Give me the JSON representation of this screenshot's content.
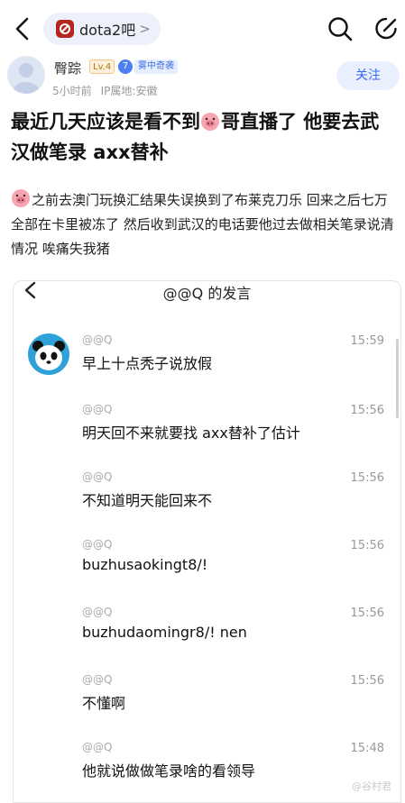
{
  "nav": {
    "forum_name": "dota2吧",
    "chevron": ">"
  },
  "author": {
    "name": "臀踪",
    "level": "Lv.4",
    "badge_number": "7",
    "badge_text": "雾中奇袭",
    "time": "5小时前",
    "ip_location": "IP属地:安徽",
    "follow_label": "关注"
  },
  "post": {
    "title_part1": "最近几天应该是看不到",
    "title_part2": "哥直播了 他要去武汉做笔录 axx替补",
    "body_text": "之前去澳门玩换汇结果失误换到了布莱克刀乐 回来之后七万全部在卡里被冻了 然后收到武汉的电话要他过去做相关笔录说清情况 唉痛失我猪"
  },
  "screenshot": {
    "title": "@@Q 的发言",
    "messages": [
      {
        "sender": "@@Q",
        "time": "15:59",
        "text": "早上十点秃子说放假"
      },
      {
        "sender": "@@Q",
        "time": "15:56",
        "text": "明天回不来就要找 axx替补了估计"
      },
      {
        "sender": "@@Q",
        "time": "15:56",
        "text": "不知道明天能回来不"
      },
      {
        "sender": "@@Q",
        "time": "15:56",
        "text": "buzhusaokingt8/!"
      },
      {
        "sender": "@@Q",
        "time": "15:56",
        "text": "buzhudaomingr8/!  nen"
      },
      {
        "sender": "@@Q",
        "time": "15:56",
        "text": "不懂啊"
      },
      {
        "sender": "@@Q",
        "time": "15:48",
        "text": "他就说做做笔录啥的看领导"
      }
    ]
  },
  "watermark": "@谷村君",
  "colors": {
    "accent": "#3766f4",
    "forum_pill_bg": "#eef0fb",
    "follow_bg": "#eaf0fe",
    "level_text": "#b47718",
    "badge_blue": "#4b7ff2"
  },
  "icons": [
    "back-arrow-icon",
    "forum-logo-icon",
    "search-icon",
    "share-icon",
    "pig-emoji-icon",
    "panda-avatar-icon"
  ]
}
